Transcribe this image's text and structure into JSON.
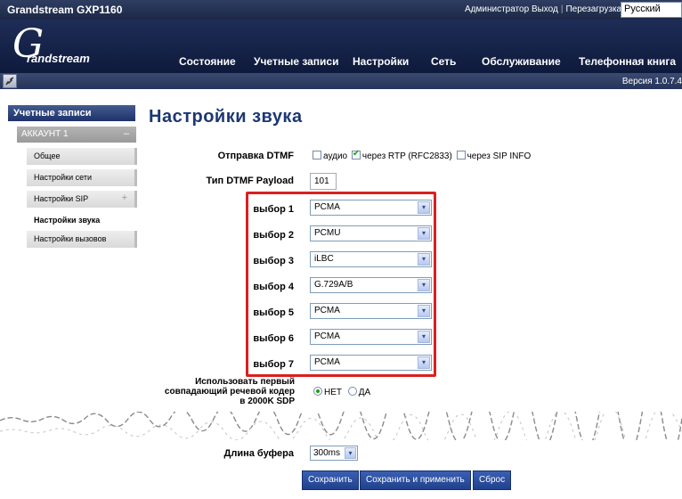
{
  "app": {
    "title": "Grandstream GXP1160",
    "admin_link": "Администратор",
    "logout_link": "Выход",
    "reboot_link": "Перезагрузка",
    "language": "Русский",
    "logo_letter": "G",
    "logo_text": "randstream",
    "version": "Версия 1.0.7.4"
  },
  "menu": [
    "Состояние",
    "Учетные записи",
    "Настройки",
    "Сеть",
    "Обслуживание",
    "Телефонная книга"
  ],
  "sidebar": {
    "header": "Учетные записи",
    "account": "АККАУНТ 1",
    "account_toggle": "–",
    "items": [
      {
        "label": "Общее"
      },
      {
        "label": "Настройки сети"
      },
      {
        "label": "Настройки SIP",
        "toggle": "+"
      },
      {
        "label": "Настройки звука",
        "active": true
      },
      {
        "label": "Настройки вызовов"
      }
    ]
  },
  "page": {
    "title": "Настройки звука",
    "dtmf": {
      "label": "Отправка DTMF",
      "options": [
        {
          "label": "аудио",
          "checked": false
        },
        {
          "label": "через RTP (RFC2833)",
          "checked": true
        },
        {
          "label": "через SIP INFO",
          "checked": false
        }
      ]
    },
    "payload": {
      "label": "Тип DTMF Payload",
      "value": "101"
    },
    "codecs": [
      {
        "label": "выбор 1",
        "value": "PCMA"
      },
      {
        "label": "выбор 2",
        "value": "PCMU"
      },
      {
        "label": "выбор 3",
        "value": "iLBC"
      },
      {
        "label": "выбор 4",
        "value": "G.729A/B"
      },
      {
        "label": "выбор 5",
        "value": "PCMA"
      },
      {
        "label": "выбор 6",
        "value": "PCMA"
      },
      {
        "label": "выбор 7",
        "value": "PCMA"
      }
    ],
    "first_match": {
      "label_line1": "Использовать первый",
      "label_line2": "совпадающий речевой кодер",
      "label_line3": "в 2000K SDP",
      "options": [
        {
          "label": "НЕТ",
          "selected": true
        },
        {
          "label": "ДА",
          "selected": false
        }
      ]
    },
    "buffer": {
      "label": "Длина буфера",
      "value": "300ms"
    },
    "buttons": {
      "save": "Сохранить",
      "save_apply": "Сохранить и применить",
      "reset": "Сброс"
    }
  },
  "colors": {
    "header_bg": "#1c2845",
    "title": "#1c3873",
    "highlight": "#d92020",
    "button": "#2a4b9c"
  },
  "icons": {
    "dropdown": "▾",
    "check": "✔",
    "phone": "phone-icon"
  }
}
